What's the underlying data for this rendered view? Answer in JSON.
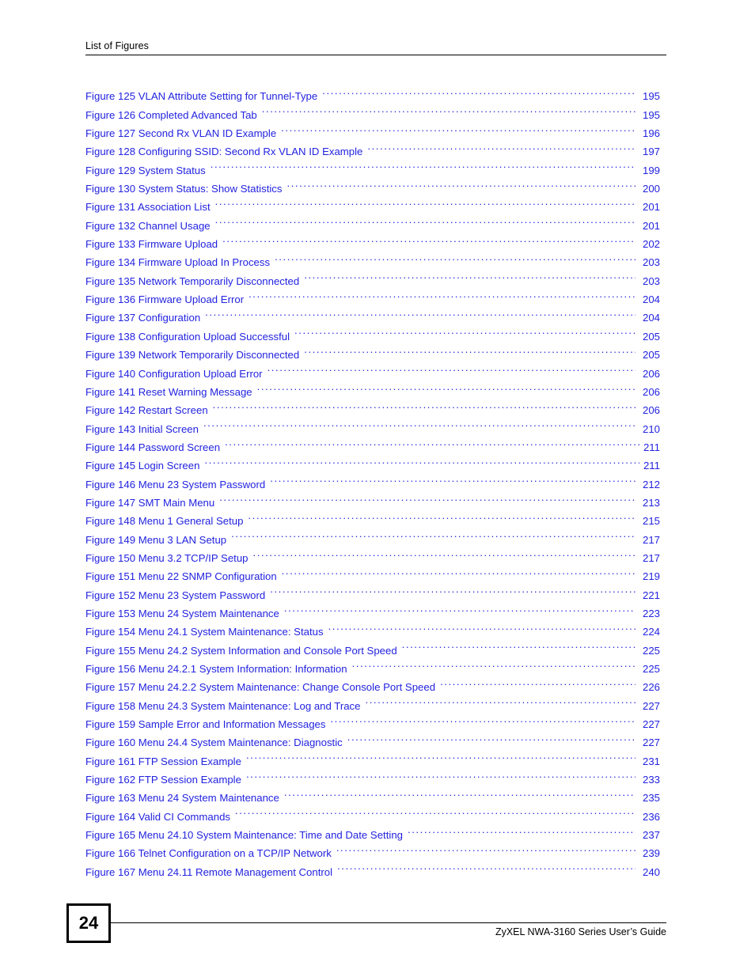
{
  "header": {
    "title": "List of Figures"
  },
  "toc": {
    "entries": [
      {
        "label": "Figure 125 VLAN Attribute Setting for Tunnel-Type",
        "page": "195"
      },
      {
        "label": "Figure 126 Completed Advanced Tab",
        "page": "195"
      },
      {
        "label": "Figure 127 Second Rx VLAN ID Example",
        "page": "196"
      },
      {
        "label": "Figure 128 Configuring SSID: Second Rx VLAN ID Example",
        "page": "197"
      },
      {
        "label": "Figure 129 System Status",
        "page": "199"
      },
      {
        "label": "Figure 130 System Status: Show Statistics",
        "page": "200"
      },
      {
        "label": "Figure 131 Association List",
        "page": "201"
      },
      {
        "label": "Figure 132 Channel Usage",
        "page": "201"
      },
      {
        "label": "Figure 133 Firmware Upload",
        "page": "202"
      },
      {
        "label": "Figure 134 Firmware Upload In Process",
        "page": "203"
      },
      {
        "label": "Figure 135 Network Temporarily Disconnected",
        "page": "203"
      },
      {
        "label": "Figure 136 Firmware Upload Error",
        "page": "204"
      },
      {
        "label": "Figure 137 Configuration",
        "page": "204"
      },
      {
        "label": "Figure 138 Configuration Upload Successful",
        "page": "205"
      },
      {
        "label": "Figure 139 Network Temporarily Disconnected",
        "page": "205"
      },
      {
        "label": "Figure 140 Configuration Upload Error",
        "page": "206"
      },
      {
        "label": "Figure 141 Reset Warning Message",
        "page": "206"
      },
      {
        "label": "Figure 142 Restart Screen",
        "page": "206"
      },
      {
        "label": "Figure 143 Initial Screen",
        "page": "210"
      },
      {
        "label": "Figure 144 Password Screen",
        "page": "211",
        "tight": true
      },
      {
        "label": "Figure 145 Login Screen",
        "page": "211",
        "tight": true
      },
      {
        "label": "Figure 146 Menu 23 System Password",
        "page": "212"
      },
      {
        "label": "Figure 147 SMT Main Menu",
        "page": "213"
      },
      {
        "label": "Figure 148 Menu 1 General Setup",
        "page": "215"
      },
      {
        "label": "Figure 149 Menu 3 LAN Setup",
        "page": "217"
      },
      {
        "label": "Figure 150 Menu 3.2 TCP/IP Setup",
        "page": "217"
      },
      {
        "label": "Figure 151 Menu 22 SNMP Configuration",
        "page": "219"
      },
      {
        "label": "Figure 152 Menu 23 System Password",
        "page": "221"
      },
      {
        "label": "Figure 153 Menu 24 System Maintenance",
        "page": "223"
      },
      {
        "label": "Figure 154 Menu 24.1 System Maintenance: Status",
        "page": "224"
      },
      {
        "label": "Figure 155 Menu 24.2 System Information and Console Port Speed",
        "page": "225"
      },
      {
        "label": "Figure 156 Menu 24.2.1 System Information: Information",
        "page": "225"
      },
      {
        "label": "Figure 157 Menu 24.2.2 System Maintenance: Change Console Port Speed",
        "page": "226"
      },
      {
        "label": "Figure 158 Menu 24.3 System Maintenance: Log and Trace",
        "page": "227"
      },
      {
        "label": "Figure 159 Sample Error and Information Messages",
        "page": "227"
      },
      {
        "label": "Figure 160 Menu 24.4 System Maintenance: Diagnostic",
        "page": "227"
      },
      {
        "label": "Figure 161 FTP Session Example",
        "page": "231"
      },
      {
        "label": "Figure 162 FTP Session Example",
        "page": "233"
      },
      {
        "label": "Figure 163 Menu 24 System Maintenance",
        "page": "235"
      },
      {
        "label": "Figure 164 Valid CI Commands",
        "page": "236"
      },
      {
        "label": "Figure 165 Menu 24.10 System Maintenance: Time and Date Setting",
        "page": "237"
      },
      {
        "label": "Figure 166 Telnet Configuration on a TCP/IP Network",
        "page": "239"
      },
      {
        "label": "Figure 167 Menu 24.11 Remote Management Control",
        "page": "240"
      }
    ]
  },
  "footer": {
    "page_number": "24",
    "guide_title": "ZyXEL NWA-3160 Series User’s Guide"
  },
  "colors": {
    "link": "#2323e0",
    "text": "#000000",
    "background": "#ffffff"
  }
}
